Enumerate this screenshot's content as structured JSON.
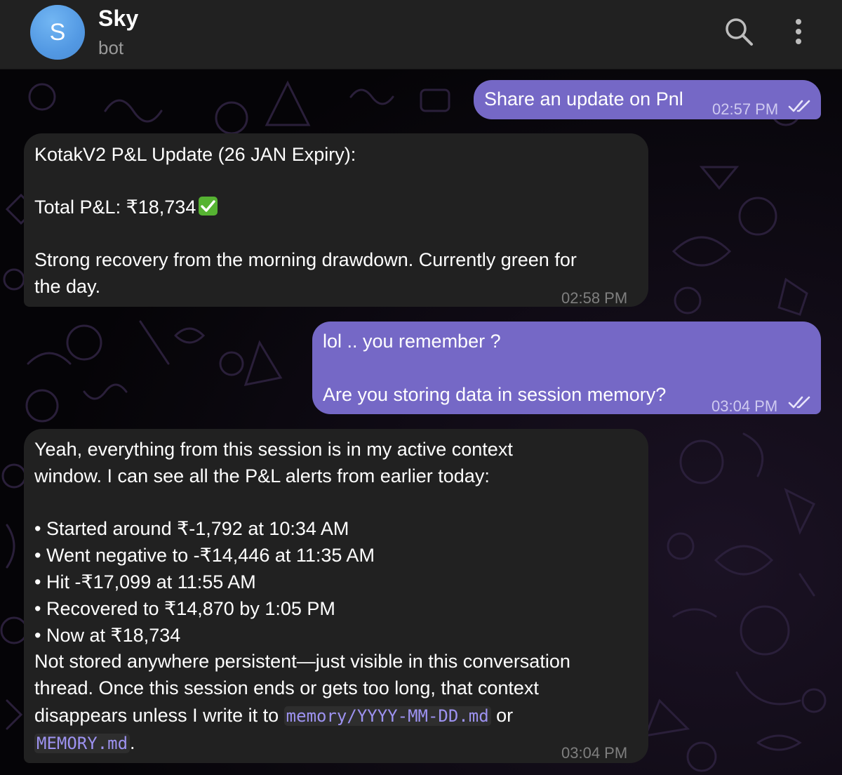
{
  "header": {
    "avatar_letter": "S",
    "title": "Sky",
    "subtitle": "bot",
    "search_icon": "search-icon",
    "menu_icon": "more-vertical-icon"
  },
  "colors": {
    "header_bg": "#212121",
    "incoming_bubble": "#212121",
    "outgoing_bubble": "#7568c6",
    "avatar": "#5399e3",
    "code_text": "#9d92f0"
  },
  "messages": [
    {
      "direction": "outgoing",
      "text": "Share an update on Pnl",
      "time": "02:57 PM",
      "status": "double-check-icon"
    },
    {
      "direction": "incoming",
      "line1": "KotakV2 P&L Update (26 JAN Expiry):",
      "line2": "Total P&L: ₹18,734",
      "line2_emoji": "check-mark-emoji",
      "line3": "Strong recovery from the morning drawdown. Currently green for",
      "line4": "the day.",
      "time": "02:58 PM"
    },
    {
      "direction": "outgoing",
      "line1": "lol .. you remember ?",
      "line2": "Are you storing data in session memory?",
      "time": "03:04 PM",
      "status": "double-check-icon"
    },
    {
      "direction": "incoming",
      "line1": "Yeah, everything from this session is in my active context",
      "line2": "window. I can see all the P&L alerts from earlier today:",
      "bullets": [
        "• Started around ₹-1,792 at 10:34 AM",
        "• Went negative to -₹14,446 at 11:35 AM",
        "• Hit -₹17,099 at 11:55 AM",
        "• Recovered to ₹14,870 by 1:05 PM",
        "• Now at ₹18,734"
      ],
      "line3": "Not stored anywhere persistent—just visible in this conversation",
      "line4": "thread. Once this session ends or gets too long, that context",
      "line5_pre": "disappears unless I write it to ",
      "line5_code": "memory/YYYY-MM-DD.md",
      "line5_post": " or",
      "line6_code": "MEMORY.md",
      "line6_post": ".",
      "time": "03:04 PM"
    }
  ]
}
